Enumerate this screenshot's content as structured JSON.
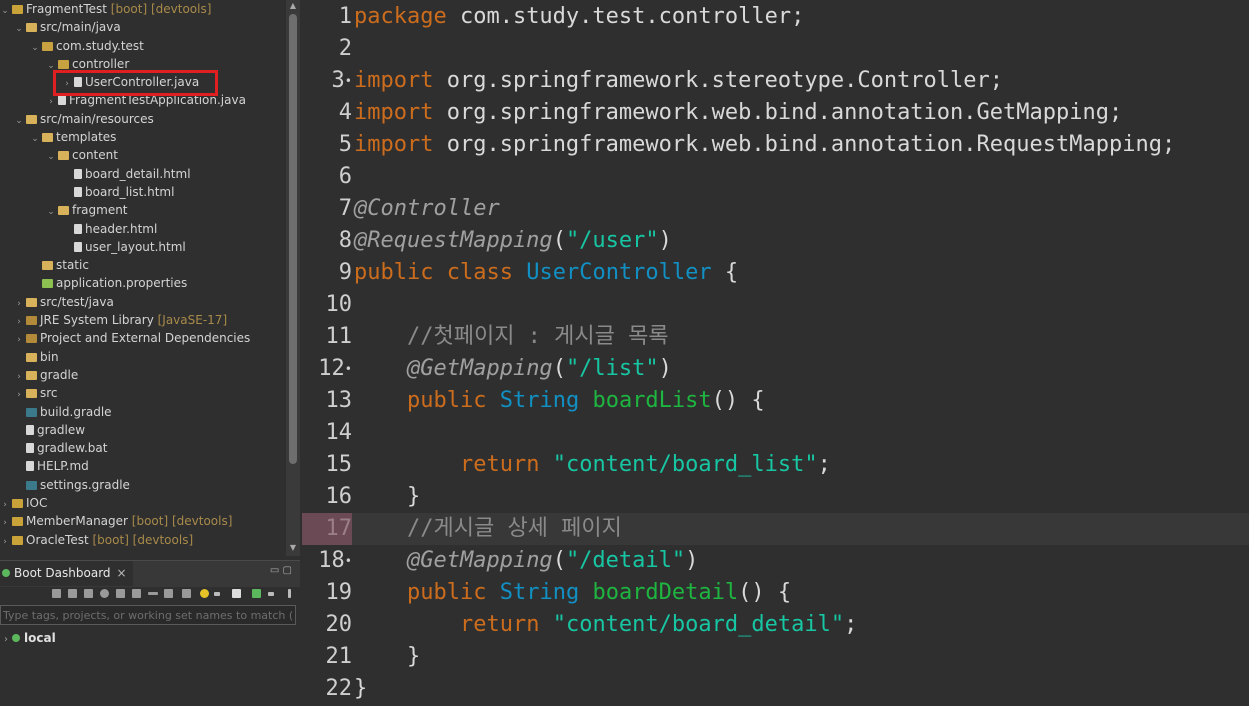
{
  "explorer": {
    "items": [
      {
        "label": "FragmentTest",
        "deco": " [boot] [devtools]",
        "indent": 0,
        "arrow": "⌄",
        "icon": "project"
      },
      {
        "label": "src/main/java",
        "deco": "",
        "indent": 1,
        "arrow": "⌄",
        "icon": "folder"
      },
      {
        "label": "com.study.test",
        "deco": "",
        "indent": 2,
        "arrow": "⌄",
        "icon": "package"
      },
      {
        "label": "controller",
        "deco": "",
        "indent": 3,
        "arrow": "⌄",
        "icon": "package"
      },
      {
        "label": "UserController.java",
        "deco": "",
        "indent": 4,
        "arrow": "›",
        "icon": "java"
      },
      {
        "label": "FragmentTestApplication.java",
        "deco": "",
        "indent": 3,
        "arrow": "›",
        "icon": "java"
      },
      {
        "label": "src/main/resources",
        "deco": "",
        "indent": 1,
        "arrow": "⌄",
        "icon": "folder"
      },
      {
        "label": "templates",
        "deco": "",
        "indent": 2,
        "arrow": "⌄",
        "icon": "folder"
      },
      {
        "label": "content",
        "deco": "",
        "indent": 3,
        "arrow": "⌄",
        "icon": "folder"
      },
      {
        "label": "board_detail.html",
        "deco": "",
        "indent": 4,
        "arrow": "",
        "icon": "file"
      },
      {
        "label": "board_list.html",
        "deco": "",
        "indent": 4,
        "arrow": "",
        "icon": "file"
      },
      {
        "label": "fragment",
        "deco": "",
        "indent": 3,
        "arrow": "⌄",
        "icon": "folder"
      },
      {
        "label": "header.html",
        "deco": "",
        "indent": 4,
        "arrow": "",
        "icon": "file"
      },
      {
        "label": "user_layout.html",
        "deco": "",
        "indent": 4,
        "arrow": "",
        "icon": "file"
      },
      {
        "label": "static",
        "deco": "",
        "indent": 2,
        "arrow": "",
        "icon": "folder"
      },
      {
        "label": "application.properties",
        "deco": "",
        "indent": 2,
        "arrow": "",
        "icon": "prop"
      },
      {
        "label": "src/test/java",
        "deco": "",
        "indent": 1,
        "arrow": "›",
        "icon": "folder"
      },
      {
        "label": "JRE System Library",
        "deco": " [JavaSE-17]",
        "indent": 1,
        "arrow": "›",
        "icon": "lib"
      },
      {
        "label": "Project and External Dependencies",
        "deco": "",
        "indent": 1,
        "arrow": "›",
        "icon": "lib"
      },
      {
        "label": "bin",
        "deco": "",
        "indent": 1,
        "arrow": "",
        "icon": "folder"
      },
      {
        "label": "gradle",
        "deco": "",
        "indent": 1,
        "arrow": "›",
        "icon": "folder"
      },
      {
        "label": "src",
        "deco": "",
        "indent": 1,
        "arrow": "›",
        "icon": "folder"
      },
      {
        "label": "build.gradle",
        "deco": "",
        "indent": 1,
        "arrow": "",
        "icon": "gradle"
      },
      {
        "label": "gradlew",
        "deco": "",
        "indent": 1,
        "arrow": "",
        "icon": "file"
      },
      {
        "label": "gradlew.bat",
        "deco": "",
        "indent": 1,
        "arrow": "",
        "icon": "file"
      },
      {
        "label": "HELP.md",
        "deco": "",
        "indent": 1,
        "arrow": "",
        "icon": "file"
      },
      {
        "label": "settings.gradle",
        "deco": "",
        "indent": 1,
        "arrow": "",
        "icon": "gradle"
      },
      {
        "label": "IOC",
        "deco": "",
        "indent": 0,
        "arrow": "›",
        "icon": "project"
      },
      {
        "label": "MemberManager",
        "deco": " [boot] [devtools]",
        "indent": 0,
        "arrow": "›",
        "icon": "project"
      },
      {
        "label": "OracleTest",
        "deco": " [boot] [devtools]",
        "indent": 0,
        "arrow": "›",
        "icon": "project"
      }
    ]
  },
  "boot_dashboard": {
    "tab_label": "Boot Dashboard",
    "close": "×",
    "minmax": "▭ ▢",
    "filter_placeholder": "Type tags, projects, or working set names to match (in",
    "local_label": "local"
  },
  "editor": {
    "current_line": 17,
    "lines": [
      {
        "n": "1",
        "fold": "",
        "tokens": [
          [
            "kw",
            "package"
          ],
          [
            "plain",
            " com.study.test.controller;"
          ]
        ]
      },
      {
        "n": "2",
        "fold": "",
        "tokens": []
      },
      {
        "n": "3",
        "fold": "•",
        "tokens": [
          [
            "kw",
            "import"
          ],
          [
            "plain",
            " org.springframework.stereotype.Controller;"
          ]
        ]
      },
      {
        "n": "4",
        "fold": "",
        "tokens": [
          [
            "kw",
            "import"
          ],
          [
            "plain",
            " org.springframework.web.bind.annotation.GetMapping;"
          ]
        ]
      },
      {
        "n": "5",
        "fold": "",
        "tokens": [
          [
            "kw",
            "import"
          ],
          [
            "plain",
            " org.springframework.web.bind.annotation.RequestMapping;"
          ]
        ]
      },
      {
        "n": "6",
        "fold": "",
        "tokens": []
      },
      {
        "n": "7",
        "fold": "",
        "tokens": [
          [
            "ann",
            "@Controller"
          ]
        ]
      },
      {
        "n": "8",
        "fold": "",
        "tokens": [
          [
            "ann",
            "@RequestMapping"
          ],
          [
            "plain",
            "("
          ],
          [
            "str",
            "\"/user\""
          ],
          [
            "plain",
            ")"
          ]
        ]
      },
      {
        "n": "9",
        "fold": "",
        "tokens": [
          [
            "kw",
            "public"
          ],
          [
            "plain",
            " "
          ],
          [
            "kw",
            "class"
          ],
          [
            "plain",
            " "
          ],
          [
            "type",
            "UserController"
          ],
          [
            "plain",
            " {"
          ]
        ]
      },
      {
        "n": "10",
        "fold": "",
        "tokens": []
      },
      {
        "n": "11",
        "fold": "",
        "tokens": [
          [
            "plain",
            "    "
          ],
          [
            "comment",
            "//첫페이지 : 게시글 목록"
          ]
        ]
      },
      {
        "n": "12",
        "fold": "•",
        "tokens": [
          [
            "plain",
            "    "
          ],
          [
            "ann",
            "@GetMapping"
          ],
          [
            "plain",
            "("
          ],
          [
            "str",
            "\"/list\""
          ],
          [
            "plain",
            ")"
          ]
        ]
      },
      {
        "n": "13",
        "fold": "",
        "tokens": [
          [
            "plain",
            "    "
          ],
          [
            "kw",
            "public"
          ],
          [
            "plain",
            " "
          ],
          [
            "type",
            "String"
          ],
          [
            "plain",
            " "
          ],
          [
            "method",
            "boardList"
          ],
          [
            "plain",
            "() {"
          ]
        ]
      },
      {
        "n": "14",
        "fold": "",
        "tokens": []
      },
      {
        "n": "15",
        "fold": "",
        "tokens": [
          [
            "plain",
            "        "
          ],
          [
            "kw",
            "return"
          ],
          [
            "plain",
            " "
          ],
          [
            "str",
            "\"content/board_list\""
          ],
          [
            "plain",
            ";"
          ]
        ]
      },
      {
        "n": "16",
        "fold": "",
        "tokens": [
          [
            "plain",
            "    }"
          ]
        ]
      },
      {
        "n": "17",
        "fold": "",
        "tokens": [
          [
            "plain",
            "    "
          ],
          [
            "comment",
            "//게시글 상세 페이지"
          ]
        ]
      },
      {
        "n": "18",
        "fold": "•",
        "tokens": [
          [
            "plain",
            "    "
          ],
          [
            "ann",
            "@GetMapping"
          ],
          [
            "plain",
            "("
          ],
          [
            "str",
            "\"/detail\""
          ],
          [
            "plain",
            ")"
          ]
        ]
      },
      {
        "n": "19",
        "fold": "",
        "tokens": [
          [
            "plain",
            "    "
          ],
          [
            "kw",
            "public"
          ],
          [
            "plain",
            " "
          ],
          [
            "type",
            "String"
          ],
          [
            "plain",
            " "
          ],
          [
            "method",
            "boardDetail"
          ],
          [
            "plain",
            "() {"
          ]
        ]
      },
      {
        "n": "20",
        "fold": "",
        "tokens": [
          [
            "plain",
            "        "
          ],
          [
            "kw",
            "return"
          ],
          [
            "plain",
            " "
          ],
          [
            "str",
            "\"content/board_detail\""
          ],
          [
            "plain",
            ";"
          ]
        ]
      },
      {
        "n": "21",
        "fold": "",
        "tokens": [
          [
            "plain",
            "    }"
          ]
        ]
      },
      {
        "n": "22",
        "fold": "",
        "tokens": [
          [
            "plain",
            "}"
          ]
        ]
      }
    ]
  }
}
